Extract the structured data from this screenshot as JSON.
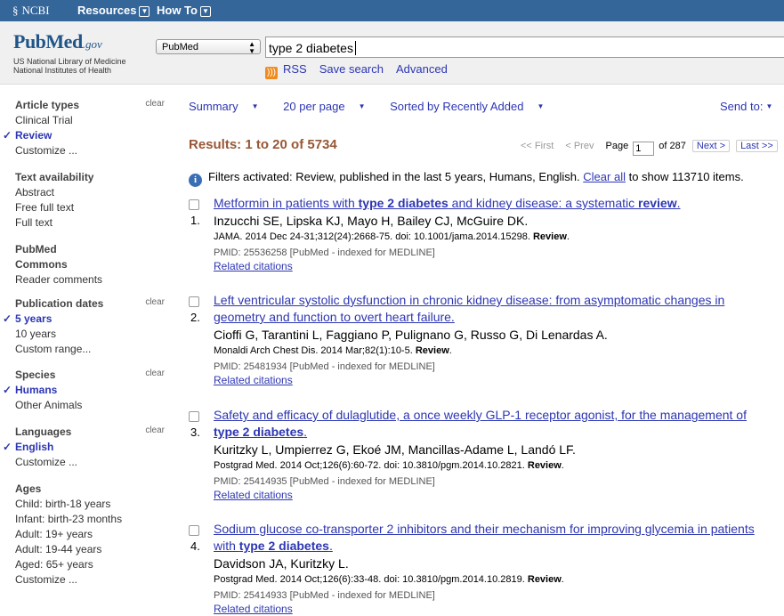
{
  "topbar": {
    "brand": "NCBI",
    "menus": [
      "Resources",
      "How To"
    ]
  },
  "header": {
    "logo_pub": "Pub",
    "logo_med": "Med",
    "logo_gov": ".gov",
    "nlm_line1": "US National Library of Medicine",
    "nlm_line2": "National Institutes of Health",
    "database": "PubMed",
    "query": "type 2 diabetes",
    "links": [
      "RSS",
      "Save search",
      "Advanced"
    ]
  },
  "sidebar": {
    "clear_label": "clear",
    "groups": [
      {
        "title": "Article types",
        "clearable": true,
        "items": [
          {
            "label": "Clinical Trial",
            "selected": false
          },
          {
            "label": "Review",
            "selected": true
          },
          {
            "label": "Customize ...",
            "selected": false
          }
        ]
      },
      {
        "title": "Text availability",
        "clearable": false,
        "items": [
          {
            "label": "Abstract",
            "selected": false
          },
          {
            "label": "Free full text",
            "selected": false
          },
          {
            "label": "Full text",
            "selected": false
          }
        ]
      },
      {
        "title": "PubMed Commons",
        "clearable": false,
        "items": [
          {
            "label": "Reader comments",
            "selected": false
          }
        ]
      },
      {
        "title": "Publication dates",
        "clearable": true,
        "items": [
          {
            "label": "5 years",
            "selected": true
          },
          {
            "label": "10 years",
            "selected": false
          },
          {
            "label": "Custom range...",
            "selected": false
          }
        ]
      },
      {
        "title": "Species",
        "clearable": true,
        "items": [
          {
            "label": "Humans",
            "selected": true
          },
          {
            "label": "Other Animals",
            "selected": false
          }
        ]
      },
      {
        "title": "Languages",
        "clearable": true,
        "items": [
          {
            "label": "English",
            "selected": true
          },
          {
            "label": "Customize ...",
            "selected": false
          }
        ]
      },
      {
        "title": "Ages",
        "clearable": false,
        "items": [
          {
            "label": "Child: birth-18 years",
            "selected": false
          },
          {
            "label": "Infant: birth-23 months",
            "selected": false
          },
          {
            "label": "Adult: 19+ years",
            "selected": false
          },
          {
            "label": "Adult: 19-44 years",
            "selected": false
          },
          {
            "label": "Aged: 65+ years",
            "selected": false
          },
          {
            "label": "Customize ...",
            "selected": false
          }
        ]
      }
    ]
  },
  "toolbar": {
    "format": "Summary",
    "per_page": "20 per page",
    "sort": "Sorted by Recently Added",
    "send_to": "Send to:"
  },
  "results": {
    "summary": "Results: 1 to 20 of 5734",
    "pager": {
      "first": "<< First",
      "prev": "< Prev",
      "page_label": "Page",
      "page_value": "1",
      "of_pages": "of 287",
      "next": "Next >",
      "last": "Last >>"
    },
    "filters_text": "Filters activated: Review, published in the last 5 years, Humans, English.",
    "clear_all": "Clear all",
    "filters_suffix": "to show 113710 items.",
    "related_label": "Related citations",
    "items": [
      {
        "num": "1.",
        "title_parts": [
          {
            "text": "Metformin in patients with ",
            "bold": false
          },
          {
            "text": "type 2 diabetes",
            "bold": true
          },
          {
            "text": " and kidney disease: a systematic ",
            "bold": false
          },
          {
            "text": "review",
            "bold": true
          },
          {
            "text": ".",
            "bold": false
          }
        ],
        "authors": "Inzucchi SE, Lipska KJ, Mayo H, Bailey CJ, McGuire DK.",
        "citation": "JAMA. 2014 Dec 24-31;312(24):2668-75. doi: 10.1001/jama.2014.15298.",
        "tag": "Review",
        "pmid": "PMID: 25536258 [PubMed - indexed for MEDLINE]"
      },
      {
        "num": "2.",
        "title_parts": [
          {
            "text": "Left ventricular systolic dysfunction in chronic kidney disease: from asymptomatic changes in geometry and function to overt heart failure.",
            "bold": false
          }
        ],
        "authors": "Cioffi G, Tarantini L, Faggiano P, Pulignano G, Russo G, Di Lenardas A.",
        "citation": "Monaldi Arch Chest Dis. 2014 Mar;82(1):10-5.",
        "tag": "Review",
        "pmid": "PMID: 25481934 [PubMed - indexed for MEDLINE]"
      },
      {
        "num": "3.",
        "title_parts": [
          {
            "text": "Safety and efficacy of dulaglutide, a once weekly GLP-1 receptor agonist, for the management of ",
            "bold": false
          },
          {
            "text": "type 2 diabetes",
            "bold": true
          },
          {
            "text": ".",
            "bold": false
          }
        ],
        "authors": "Kuritzky L, Umpierrez G, Ekoé JM, Mancillas-Adame L, Landó LF.",
        "citation": "Postgrad Med. 2014 Oct;126(6):60-72. doi: 10.3810/pgm.2014.10.2821.",
        "tag": "Review",
        "pmid": "PMID: 25414935 [PubMed - indexed for MEDLINE]"
      },
      {
        "num": "4.",
        "title_parts": [
          {
            "text": "Sodium glucose co-transporter 2 inhibitors and their mechanism for improving glycemia in patients with ",
            "bold": false
          },
          {
            "text": "type 2 diabetes",
            "bold": true
          },
          {
            "text": ".",
            "bold": false
          }
        ],
        "authors": "Davidson JA, Kuritzky L.",
        "citation": "Postgrad Med. 2014 Oct;126(6):33-48. doi: 10.3810/pgm.2014.10.2819.",
        "tag": "Review",
        "pmid": "PMID: 25414933 [PubMed - indexed for MEDLINE]"
      }
    ]
  }
}
